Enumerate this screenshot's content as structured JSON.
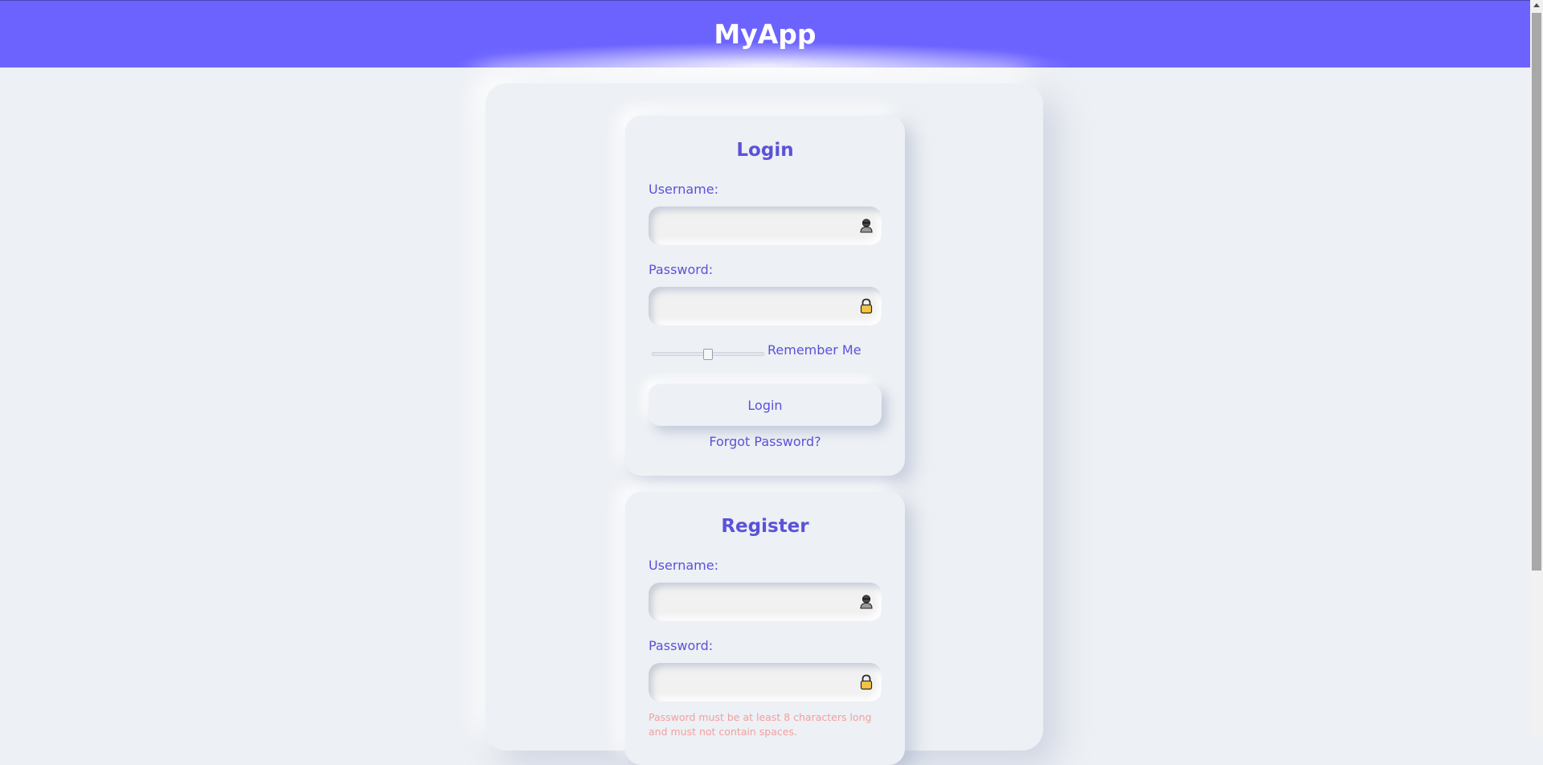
{
  "header": {
    "title": "MyApp",
    "background": "#6c63ff"
  },
  "login": {
    "title": "Login",
    "username_label": "Username:",
    "username_value": "",
    "username_icon": "user-icon",
    "password_label": "Password:",
    "password_value": "",
    "password_icon": "lock-icon",
    "remember_label": "Remember Me",
    "remember_level": 0.5,
    "button_label": "Login",
    "forgot_label": "Forgot Password?"
  },
  "register": {
    "title": "Register",
    "username_label": "Username:",
    "username_value": "",
    "username_icon": "user-icon",
    "password_label": "Password:",
    "password_value": "",
    "password_icon": "lock-icon",
    "password_hint": "Password must be at least 8 characters long and must not contain spaces."
  },
  "colors": {
    "accent": "#5a52d8",
    "page_background": "#edf0f4",
    "hint": "#f2a0a0"
  }
}
